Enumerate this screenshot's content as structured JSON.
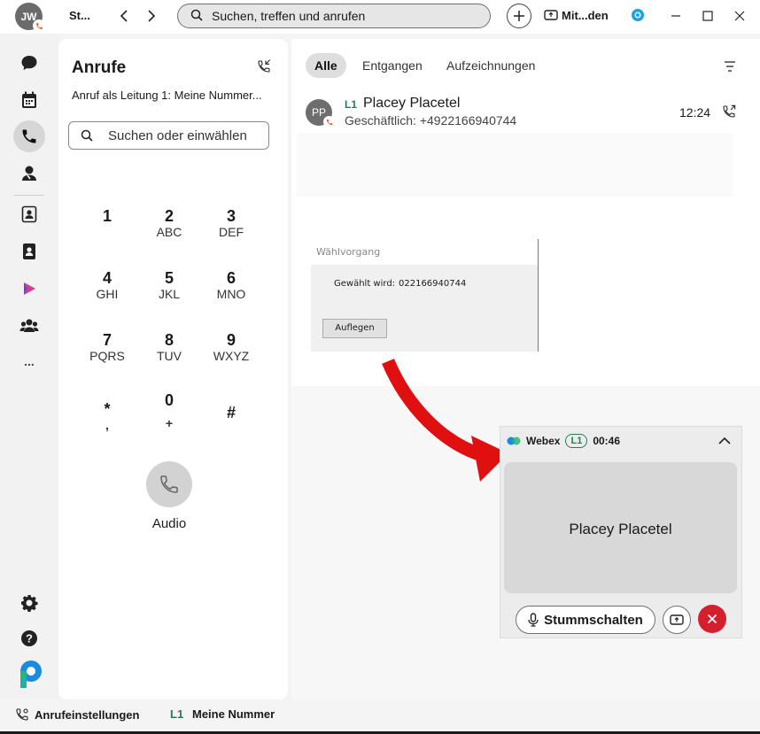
{
  "titlebar": {
    "avatar_initials": "JW",
    "status": "St...",
    "search_placeholder": "Suchen, treffen und anrufen",
    "meet_label": "Mit...den"
  },
  "sidebar": {
    "items": [
      {
        "name": "messaging",
        "icon": "chat-icon"
      },
      {
        "name": "calendar",
        "icon": "calendar-icon"
      },
      {
        "name": "calling",
        "icon": "phone-icon",
        "active": true
      },
      {
        "name": "contacts-voicemail",
        "icon": "person-phone-icon"
      },
      {
        "name": "directory",
        "icon": "contact-card-icon"
      },
      {
        "name": "address-book",
        "icon": "address-book-icon"
      },
      {
        "name": "webex-apps",
        "icon": "play-icon"
      },
      {
        "name": "teams",
        "icon": "people-icon"
      },
      {
        "name": "more",
        "label": "..."
      }
    ]
  },
  "calls": {
    "title": "Anrufe",
    "line_info": "Anruf als Leitung 1: Meine Nummer...",
    "dial_placeholder": "Suchen oder einwählen",
    "keypad": [
      {
        "digit": "1",
        "letters": ""
      },
      {
        "digit": "2",
        "letters": "ABC"
      },
      {
        "digit": "3",
        "letters": "DEF"
      },
      {
        "digit": "4",
        "letters": "GHI"
      },
      {
        "digit": "5",
        "letters": "JKL"
      },
      {
        "digit": "6",
        "letters": "MNO"
      },
      {
        "digit": "7",
        "letters": "PQRS"
      },
      {
        "digit": "8",
        "letters": "TUV"
      },
      {
        "digit": "9",
        "letters": "WXYZ"
      },
      {
        "digit": "*",
        "letters": ","
      },
      {
        "digit": "0",
        "letters": "+"
      },
      {
        "digit": "#",
        "letters": ""
      }
    ],
    "audio_label": "Audio"
  },
  "history": {
    "tabs": [
      "Alle",
      "Entgangen",
      "Aufzeichnungen"
    ],
    "active_tab": "Alle",
    "records": [
      {
        "initials": "PP",
        "line": "L1",
        "name": "Placey Placetel",
        "number": "Geschäftlich: +4922166940744",
        "time": "12:24"
      }
    ]
  },
  "dial_dialog": {
    "title": "Wählvorgang",
    "label": "Gewählt wird:",
    "number": "022166940744",
    "button": "Auflegen"
  },
  "call_window": {
    "app": "Webex",
    "line": "L1",
    "duration": "00:46",
    "caller": "Placey Placetel",
    "mute_label": "Stummschalten"
  },
  "bottombar": {
    "settings_label": "Anrufeinstellungen",
    "line": "L1",
    "number_label": "Meine Nummer"
  },
  "colors": {
    "accent_green": "#2a7a5a",
    "end_call_red": "#d41f2f",
    "arrow_red": "#e01010",
    "badge_orange": "#e8541a"
  }
}
